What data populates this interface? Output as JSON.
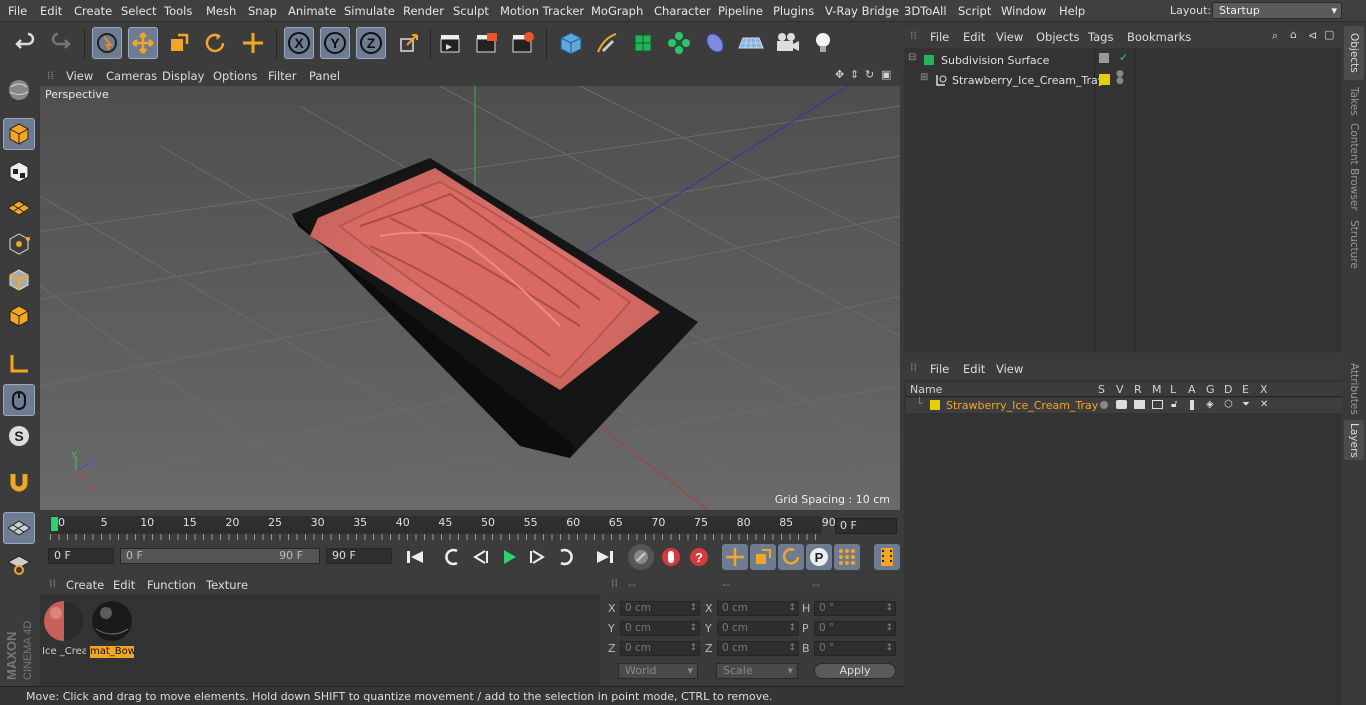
{
  "menubar": {
    "items": [
      "File",
      "Edit",
      "Create",
      "Select",
      "Tools",
      "Mesh",
      "Snap",
      "Animate",
      "Simulate",
      "Render",
      "Sculpt",
      "Motion Tracker",
      "MoGraph",
      "Character",
      "Pipeline",
      "Plugins",
      "V-Ray Bridge",
      "3DToAll",
      "Script",
      "Window",
      "Help"
    ],
    "layout_label": "Layout:",
    "layout_value": "Startup"
  },
  "viewport": {
    "menu": [
      "View",
      "Cameras",
      "Display",
      "Options",
      "Filter",
      "Panel"
    ],
    "label": "Perspective",
    "grid_spacing": "Grid Spacing : 10 cm"
  },
  "timeline": {
    "ticks": [
      "0",
      "5",
      "10",
      "15",
      "20",
      "25",
      "30",
      "35",
      "40",
      "45",
      "50",
      "55",
      "60",
      "65",
      "70",
      "75",
      "80",
      "85",
      "90"
    ],
    "current_frame": "0 F"
  },
  "transport": {
    "start": "0 F",
    "range_start": "0 F",
    "range_end": "90 F",
    "end": "90 F"
  },
  "materials": {
    "menu": [
      "Create",
      "Edit",
      "Function",
      "Texture"
    ],
    "items": [
      {
        "name": "Ice _Crea",
        "selected": false
      },
      {
        "name": "mat_Bow",
        "selected": true
      }
    ]
  },
  "coords": {
    "headers": [
      "--",
      "--",
      "--"
    ],
    "rows": [
      {
        "a": "X",
        "av": "0 cm",
        "b": "X",
        "bv": "0 cm",
        "c": "H",
        "cv": "0 °"
      },
      {
        "a": "Y",
        "av": "0 cm",
        "b": "Y",
        "bv": "0 cm",
        "c": "P",
        "cv": "0 °"
      },
      {
        "a": "Z",
        "av": "0 cm",
        "b": "Z",
        "bv": "0 cm",
        "c": "B",
        "cv": "0 °"
      }
    ],
    "mode1": "World",
    "mode2": "Scale",
    "apply": "Apply"
  },
  "status": "Move: Click and drag to move elements. Hold down SHIFT to quantize movement / add to the selection in point mode, CTRL to remove.",
  "object_manager": {
    "menu": [
      "File",
      "Edit",
      "View",
      "Objects",
      "Tags",
      "Bookmarks"
    ],
    "objects": [
      "Subdivision Surface",
      "Strawberry_Ice_Cream_Tray"
    ]
  },
  "layer_manager": {
    "menu": [
      "File",
      "Edit",
      "View"
    ],
    "columns": [
      "Name",
      "S",
      "V",
      "R",
      "M",
      "L",
      "A",
      "G",
      "D",
      "E",
      "X"
    ],
    "layers": [
      "Strawberry_Ice_Cream_Tray"
    ]
  },
  "right_tabs": [
    "Objects",
    "Takes",
    "Content Browser",
    "Structure",
    "Attributes",
    "Layers"
  ],
  "brand": {
    "maxon": "MAXON",
    "product": "CINEMA 4D"
  },
  "colors": {
    "accent": "#6e7c92",
    "layer_yellow": "#e4d000",
    "selection_orange": "#f3a623",
    "icecream": "#d9726a"
  }
}
